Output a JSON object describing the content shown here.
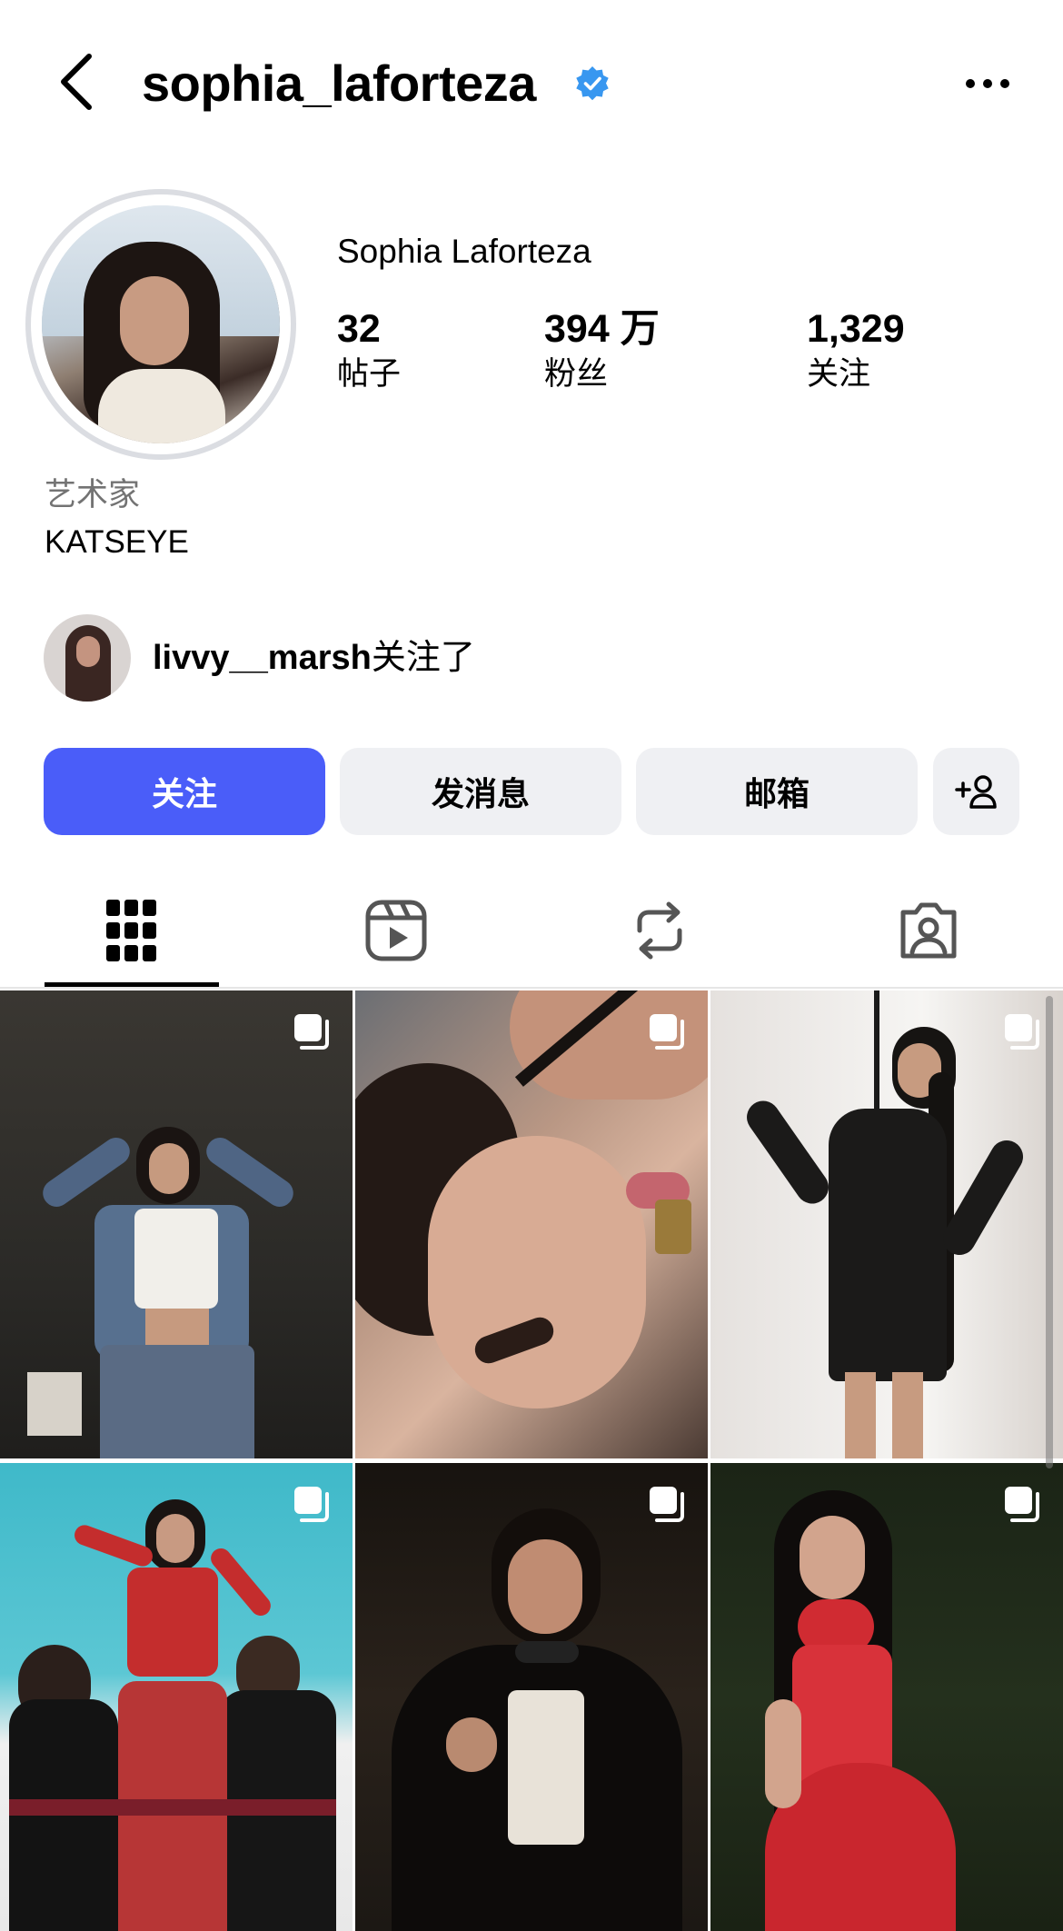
{
  "header": {
    "username": "sophia_laforteza",
    "verified": true,
    "icons": {
      "back": "chevron-left-icon",
      "verified": "verified-badge-icon",
      "more": "more-horizontal-icon"
    }
  },
  "profile": {
    "display_name": "Sophia Laforteza",
    "stats": [
      {
        "value": "32",
        "label": "帖子"
      },
      {
        "value": "394 万",
        "label": "粉丝"
      },
      {
        "value": "1,329",
        "label": "关注"
      }
    ],
    "category": "艺术家",
    "bio": "KATSEYE"
  },
  "followed_by": {
    "username": "livvy__marsh",
    "suffix": "关注了"
  },
  "actions": {
    "follow": "关注",
    "message": "发消息",
    "email": "邮箱",
    "suggest_icon": "add-person-icon"
  },
  "tabs": [
    {
      "name": "posts",
      "icon": "grid-icon",
      "active": true
    },
    {
      "name": "reels",
      "icon": "reels-icon",
      "active": false
    },
    {
      "name": "reposts",
      "icon": "repost-icon",
      "active": false
    },
    {
      "name": "tagged",
      "icon": "tagged-person-icon",
      "active": false
    }
  ],
  "colors": {
    "follow_button": "#4a5df9",
    "secondary_button": "#eff0f3",
    "verified": "#3897f0",
    "muted_text": "#737373"
  }
}
